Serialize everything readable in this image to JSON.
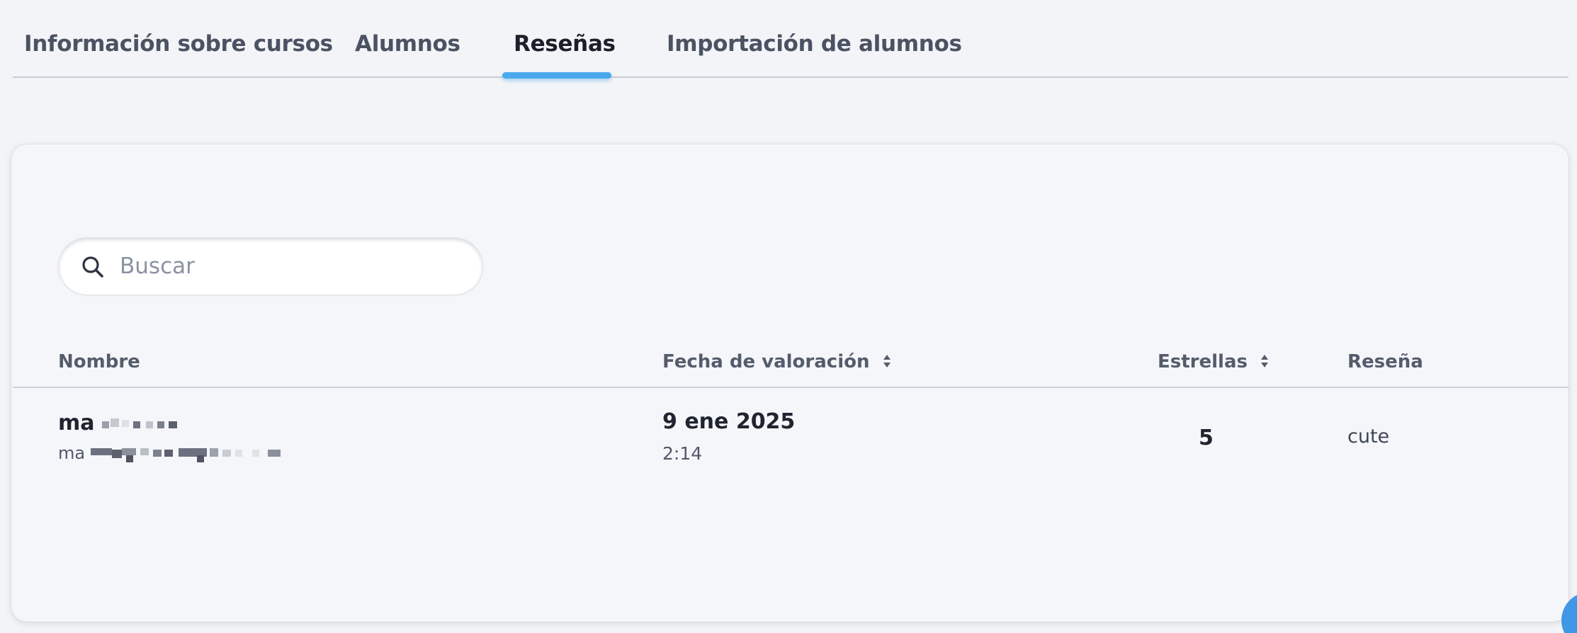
{
  "tabs": [
    {
      "label": "Información sobre cursos"
    },
    {
      "label": "Alumnos"
    },
    {
      "label": "Reseñas",
      "active": true
    },
    {
      "label": "Importación de alumnos"
    }
  ],
  "search": {
    "placeholder": "Buscar",
    "value": ""
  },
  "table": {
    "columns": {
      "name": "Nombre",
      "date": "Fecha de valoración",
      "stars": "Estrellas",
      "review": "Reseña"
    },
    "rows": [
      {
        "name_visible": "ma",
        "email_visible": "ma",
        "date": "9 ene 2025",
        "time": "2:14",
        "stars": "5",
        "review": "cute"
      }
    ]
  },
  "colors": {
    "accent": "#4aa8ee",
    "background": "#f3f4f7",
    "card": "#f5f6f9"
  }
}
